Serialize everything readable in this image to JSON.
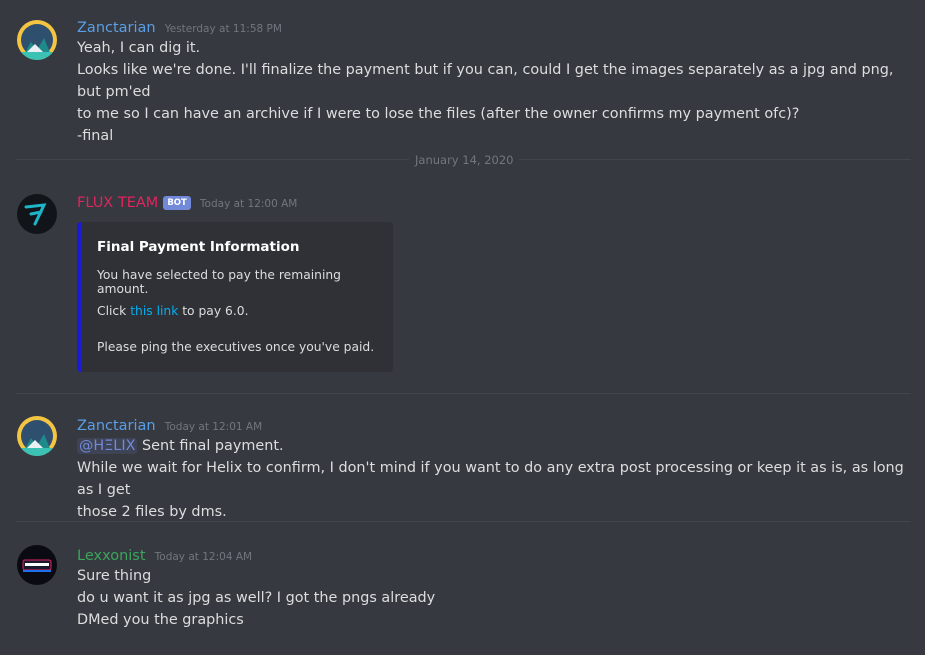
{
  "messages": [
    {
      "username": "Zanctarian",
      "username_color": "#5a9ee8",
      "timestamp": "Yesterday at 11:58 PM",
      "lines": [
        "Yeah, I can dig it.",
        "Looks like we're done. I'll finalize the payment but if you can, could I get the images separately as a jpg and png, but pm'ed",
        "to me so I can have an archive if I were to lose the files (after the owner confirms my payment ofc)?",
        "-final"
      ]
    },
    {
      "username": "FLUX TEAM",
      "username_color": "#e0245e",
      "bot_tag": "BOT",
      "timestamp": "Today at 12:00 AM",
      "embed": {
        "accent_color": "#1a1ad8",
        "title": "Final Payment Information",
        "line1": "You have selected to pay the remaining amount.",
        "line2_prefix": "Click ",
        "line2_link": "this link",
        "line2_suffix": " to pay 6.0.",
        "line3": "Please ping the executives once you've paid."
      }
    },
    {
      "username": "Zanctarian",
      "username_color": "#5a9ee8",
      "timestamp": "Today at 12:01 AM",
      "mention": "@HΞLIX",
      "first_line_rest": " Sent final payment.",
      "lines": [
        "While we wait for Helix to confirm, I don't mind if you want to do any extra post processing or keep it as is, as long as I get",
        "those 2 files by dms."
      ]
    },
    {
      "username": "Lexxonist",
      "username_color": "#3ba55c",
      "timestamp": "Today at 12:04 AM",
      "lines": [
        "Sure thing",
        "do u want it as jpg as well? I got the pngs already",
        "DMed you the graphics"
      ]
    }
  ],
  "date_divider": "January 14, 2020"
}
